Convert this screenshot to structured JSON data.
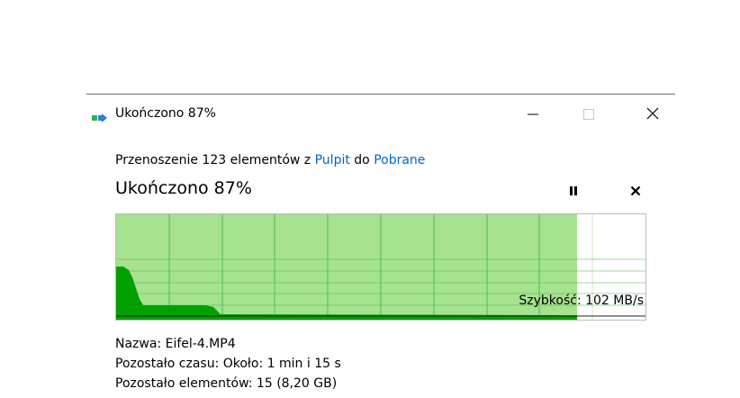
{
  "window": {
    "title": "Ukończono 87%"
  },
  "summary": {
    "prefix": "Przenoszenie 123 elementów z ",
    "source": "Pulpit",
    "middle": " do ",
    "destination": "Pobrane"
  },
  "status": {
    "heading": "Ukończono 87%",
    "progress_fraction": 0.87
  },
  "graph": {
    "speed_label": "Szybkość: 102 MB/s",
    "fill_color": "#a6e28f",
    "curve_color": "#00a000",
    "grid_color": "#4cbf4c"
  },
  "details": {
    "name": "Nazwa:  Eifel-4.MP4",
    "time_remaining": "Pozostało czasu:  Około: 1 min i 15 s",
    "items_remaining": "Pozostało elementów:  15 (8,20 GB)"
  },
  "icons": {
    "app": "move-files-icon",
    "minimize": "minimize-icon",
    "maximize": "maximize-icon",
    "close": "close-icon",
    "pause": "pause-icon",
    "cancel": "cancel-icon"
  }
}
